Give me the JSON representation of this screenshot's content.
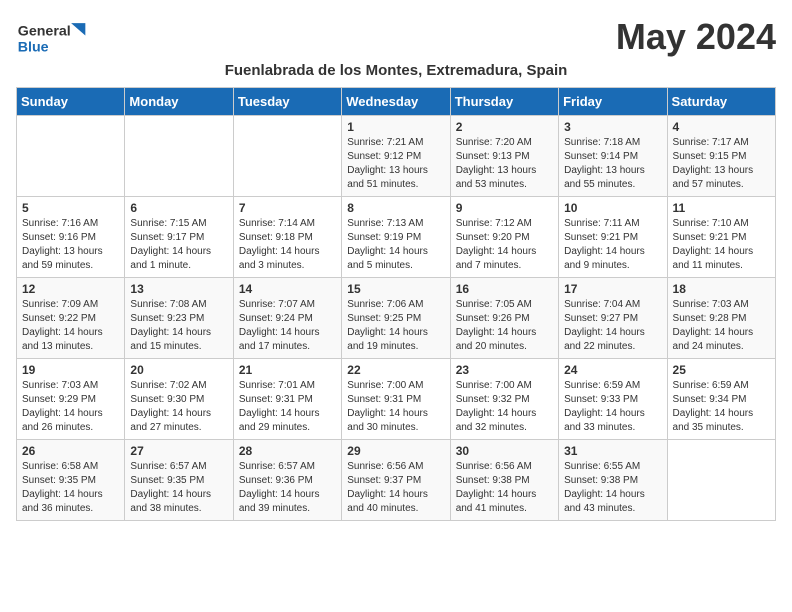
{
  "header": {
    "logo_general": "General",
    "logo_blue": "Blue",
    "month_title": "May 2024",
    "location": "Fuenlabrada de los Montes, Extremadura, Spain"
  },
  "days_of_week": [
    "Sunday",
    "Monday",
    "Tuesday",
    "Wednesday",
    "Thursday",
    "Friday",
    "Saturday"
  ],
  "weeks": [
    [
      {
        "day": "",
        "sunrise": "",
        "sunset": "",
        "daylight": ""
      },
      {
        "day": "",
        "sunrise": "",
        "sunset": "",
        "daylight": ""
      },
      {
        "day": "",
        "sunrise": "",
        "sunset": "",
        "daylight": ""
      },
      {
        "day": "1",
        "sunrise": "Sunrise: 7:21 AM",
        "sunset": "Sunset: 9:12 PM",
        "daylight": "Daylight: 13 hours and 51 minutes."
      },
      {
        "day": "2",
        "sunrise": "Sunrise: 7:20 AM",
        "sunset": "Sunset: 9:13 PM",
        "daylight": "Daylight: 13 hours and 53 minutes."
      },
      {
        "day": "3",
        "sunrise": "Sunrise: 7:18 AM",
        "sunset": "Sunset: 9:14 PM",
        "daylight": "Daylight: 13 hours and 55 minutes."
      },
      {
        "day": "4",
        "sunrise": "Sunrise: 7:17 AM",
        "sunset": "Sunset: 9:15 PM",
        "daylight": "Daylight: 13 hours and 57 minutes."
      }
    ],
    [
      {
        "day": "5",
        "sunrise": "Sunrise: 7:16 AM",
        "sunset": "Sunset: 9:16 PM",
        "daylight": "Daylight: 13 hours and 59 minutes."
      },
      {
        "day": "6",
        "sunrise": "Sunrise: 7:15 AM",
        "sunset": "Sunset: 9:17 PM",
        "daylight": "Daylight: 14 hours and 1 minute."
      },
      {
        "day": "7",
        "sunrise": "Sunrise: 7:14 AM",
        "sunset": "Sunset: 9:18 PM",
        "daylight": "Daylight: 14 hours and 3 minutes."
      },
      {
        "day": "8",
        "sunrise": "Sunrise: 7:13 AM",
        "sunset": "Sunset: 9:19 PM",
        "daylight": "Daylight: 14 hours and 5 minutes."
      },
      {
        "day": "9",
        "sunrise": "Sunrise: 7:12 AM",
        "sunset": "Sunset: 9:20 PM",
        "daylight": "Daylight: 14 hours and 7 minutes."
      },
      {
        "day": "10",
        "sunrise": "Sunrise: 7:11 AM",
        "sunset": "Sunset: 9:21 PM",
        "daylight": "Daylight: 14 hours and 9 minutes."
      },
      {
        "day": "11",
        "sunrise": "Sunrise: 7:10 AM",
        "sunset": "Sunset: 9:21 PM",
        "daylight": "Daylight: 14 hours and 11 minutes."
      }
    ],
    [
      {
        "day": "12",
        "sunrise": "Sunrise: 7:09 AM",
        "sunset": "Sunset: 9:22 PM",
        "daylight": "Daylight: 14 hours and 13 minutes."
      },
      {
        "day": "13",
        "sunrise": "Sunrise: 7:08 AM",
        "sunset": "Sunset: 9:23 PM",
        "daylight": "Daylight: 14 hours and 15 minutes."
      },
      {
        "day": "14",
        "sunrise": "Sunrise: 7:07 AM",
        "sunset": "Sunset: 9:24 PM",
        "daylight": "Daylight: 14 hours and 17 minutes."
      },
      {
        "day": "15",
        "sunrise": "Sunrise: 7:06 AM",
        "sunset": "Sunset: 9:25 PM",
        "daylight": "Daylight: 14 hours and 19 minutes."
      },
      {
        "day": "16",
        "sunrise": "Sunrise: 7:05 AM",
        "sunset": "Sunset: 9:26 PM",
        "daylight": "Daylight: 14 hours and 20 minutes."
      },
      {
        "day": "17",
        "sunrise": "Sunrise: 7:04 AM",
        "sunset": "Sunset: 9:27 PM",
        "daylight": "Daylight: 14 hours and 22 minutes."
      },
      {
        "day": "18",
        "sunrise": "Sunrise: 7:03 AM",
        "sunset": "Sunset: 9:28 PM",
        "daylight": "Daylight: 14 hours and 24 minutes."
      }
    ],
    [
      {
        "day": "19",
        "sunrise": "Sunrise: 7:03 AM",
        "sunset": "Sunset: 9:29 PM",
        "daylight": "Daylight: 14 hours and 26 minutes."
      },
      {
        "day": "20",
        "sunrise": "Sunrise: 7:02 AM",
        "sunset": "Sunset: 9:30 PM",
        "daylight": "Daylight: 14 hours and 27 minutes."
      },
      {
        "day": "21",
        "sunrise": "Sunrise: 7:01 AM",
        "sunset": "Sunset: 9:31 PM",
        "daylight": "Daylight: 14 hours and 29 minutes."
      },
      {
        "day": "22",
        "sunrise": "Sunrise: 7:00 AM",
        "sunset": "Sunset: 9:31 PM",
        "daylight": "Daylight: 14 hours and 30 minutes."
      },
      {
        "day": "23",
        "sunrise": "Sunrise: 7:00 AM",
        "sunset": "Sunset: 9:32 PM",
        "daylight": "Daylight: 14 hours and 32 minutes."
      },
      {
        "day": "24",
        "sunrise": "Sunrise: 6:59 AM",
        "sunset": "Sunset: 9:33 PM",
        "daylight": "Daylight: 14 hours and 33 minutes."
      },
      {
        "day": "25",
        "sunrise": "Sunrise: 6:59 AM",
        "sunset": "Sunset: 9:34 PM",
        "daylight": "Daylight: 14 hours and 35 minutes."
      }
    ],
    [
      {
        "day": "26",
        "sunrise": "Sunrise: 6:58 AM",
        "sunset": "Sunset: 9:35 PM",
        "daylight": "Daylight: 14 hours and 36 minutes."
      },
      {
        "day": "27",
        "sunrise": "Sunrise: 6:57 AM",
        "sunset": "Sunset: 9:35 PM",
        "daylight": "Daylight: 14 hours and 38 minutes."
      },
      {
        "day": "28",
        "sunrise": "Sunrise: 6:57 AM",
        "sunset": "Sunset: 9:36 PM",
        "daylight": "Daylight: 14 hours and 39 minutes."
      },
      {
        "day": "29",
        "sunrise": "Sunrise: 6:56 AM",
        "sunset": "Sunset: 9:37 PM",
        "daylight": "Daylight: 14 hours and 40 minutes."
      },
      {
        "day": "30",
        "sunrise": "Sunrise: 6:56 AM",
        "sunset": "Sunset: 9:38 PM",
        "daylight": "Daylight: 14 hours and 41 minutes."
      },
      {
        "day": "31",
        "sunrise": "Sunrise: 6:55 AM",
        "sunset": "Sunset: 9:38 PM",
        "daylight": "Daylight: 14 hours and 43 minutes."
      },
      {
        "day": "",
        "sunrise": "",
        "sunset": "",
        "daylight": ""
      }
    ]
  ]
}
